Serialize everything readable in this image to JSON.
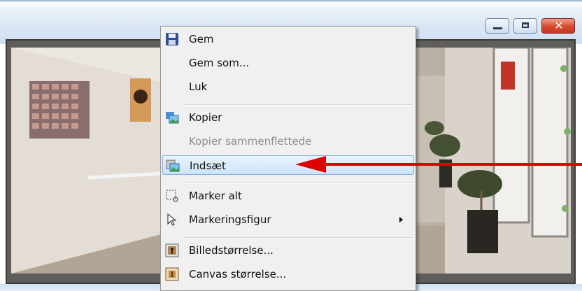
{
  "window": {
    "buttons": {
      "minimize": "minimize",
      "maximize": "maximize",
      "close": "✕"
    }
  },
  "menu": {
    "items": [
      {
        "label": "Gem",
        "icon": "floppy-disk-icon",
        "enabled": true
      },
      {
        "label": "Gem som...",
        "icon": "",
        "enabled": true
      },
      {
        "label": "Luk",
        "icon": "",
        "enabled": true
      },
      {
        "label": "Kopier",
        "icon": "copy-image-icon",
        "enabled": true
      },
      {
        "label": "Kopier sammenflettede",
        "icon": "",
        "enabled": false
      },
      {
        "label": "Indsæt",
        "icon": "paste-image-icon",
        "enabled": true,
        "highlighted": true
      },
      {
        "label": "Marker alt",
        "icon": "select-all-icon",
        "enabled": true
      },
      {
        "label": "Markeringsfigur",
        "icon": "selection-pointer-icon",
        "enabled": true,
        "has_submenu": true
      },
      {
        "label": "Billedstørrelse...",
        "icon": "image-size-icon",
        "enabled": true
      },
      {
        "label": "Canvas størrelse...",
        "icon": "canvas-size-icon",
        "enabled": true
      }
    ]
  },
  "colors": {
    "menu_background": "#f0f0f0",
    "highlight_border": "#7fb0e0",
    "annotation_arrow": "#e00000"
  }
}
